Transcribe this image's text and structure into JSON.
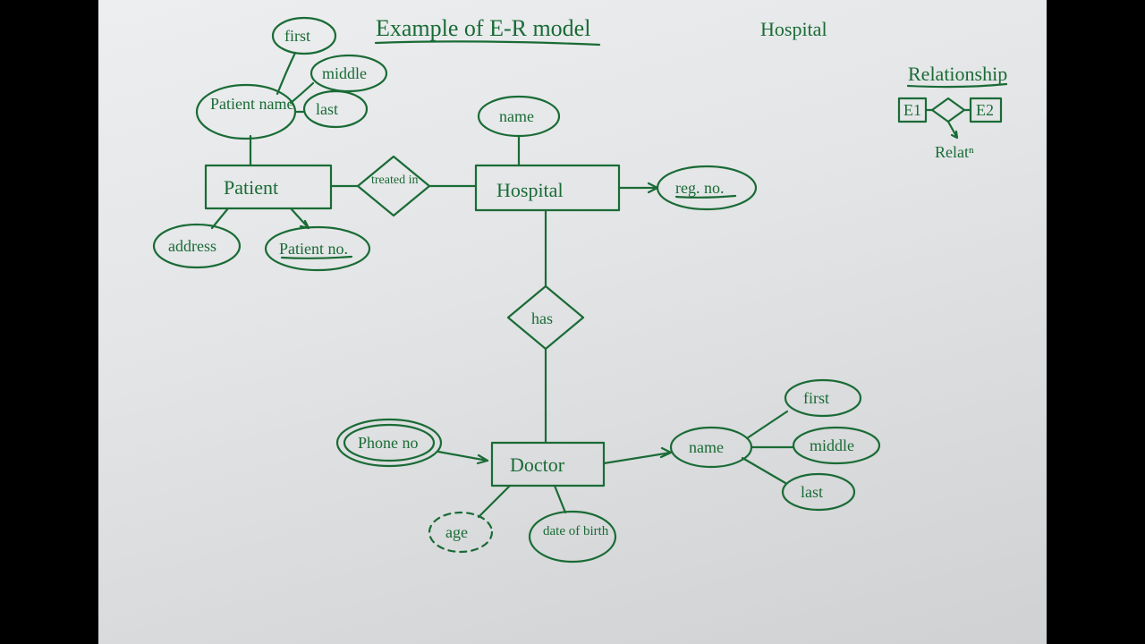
{
  "title": "Example of E-R model",
  "corner_label": "Hospital",
  "legend": {
    "heading": "Relationship",
    "left_entity": "E1",
    "right_entity": "E2",
    "caption": "Relatⁿ"
  },
  "entities": {
    "patient": "Patient",
    "hospital": "Hospital",
    "doctor": "Doctor"
  },
  "relationships": {
    "treated_in": "treated in",
    "has": "has"
  },
  "attributes": {
    "patient_name": "Patient name",
    "pn_first": "first",
    "pn_middle": "middle",
    "pn_last": "last",
    "address": "address",
    "patient_no": "Patient no.",
    "hosp_name": "name",
    "reg_no": "reg. no.",
    "phone_no": "Phone no",
    "age": "age",
    "dob": "date of birth",
    "doc_name": "name",
    "dn_first": "first",
    "dn_middle": "middle",
    "dn_last": "last"
  }
}
